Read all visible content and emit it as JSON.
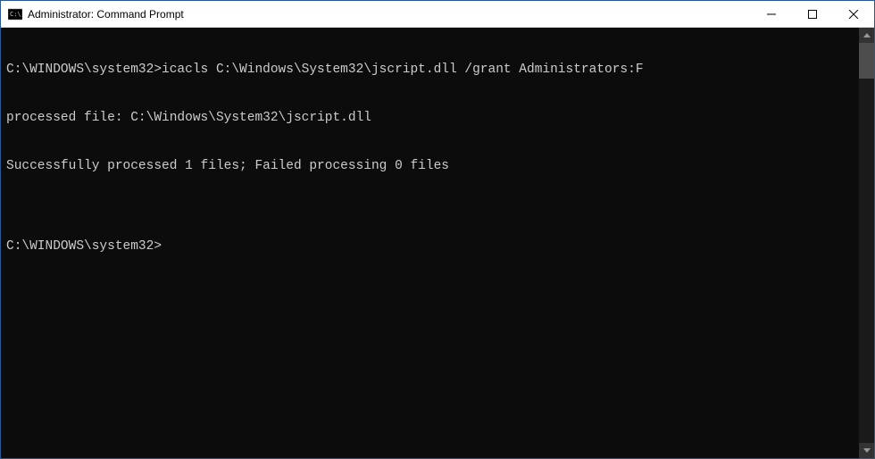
{
  "window": {
    "title": "Administrator: Command Prompt"
  },
  "terminal": {
    "lines": [
      "C:\\WINDOWS\\system32>icacls C:\\Windows\\System32\\jscript.dll /grant Administrators:F",
      "processed file: C:\\Windows\\System32\\jscript.dll",
      "Successfully processed 1 files; Failed processing 0 files",
      "",
      "C:\\WINDOWS\\system32>"
    ]
  }
}
